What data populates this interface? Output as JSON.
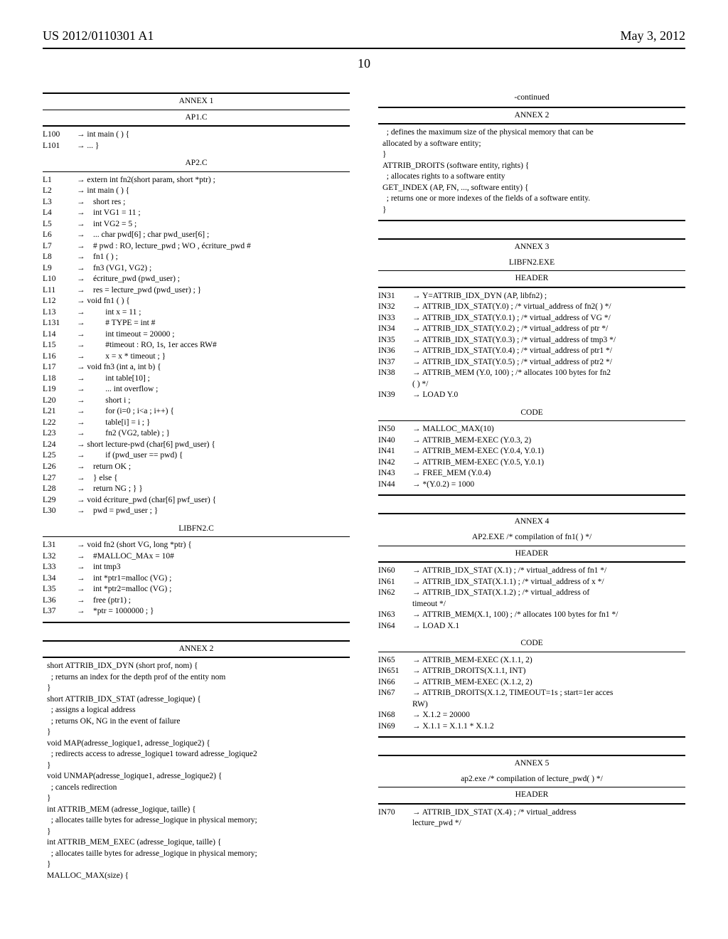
{
  "header": {
    "pub_number": "US 2012/0110301 A1",
    "pub_date": "May 3, 2012",
    "page_label": "10"
  },
  "annex1": {
    "title": "ANNEX 1",
    "sub1": "AP1.C",
    "rows1": [
      {
        "l": "L100",
        "c": "→ int main ( ) {"
      },
      {
        "l": "L101",
        "c": "→ ... }"
      }
    ],
    "sub2": "AP2.C",
    "rows2": [
      {
        "l": "L1",
        "c": "→ extern int fn2(short param, short *ptr) ;"
      },
      {
        "l": "L2",
        "c": "→ int main ( ) {"
      },
      {
        "l": "L3",
        "c": "→    short res ;"
      },
      {
        "l": "L4",
        "c": "→    int VG1 = 11 ;"
      },
      {
        "l": "L5",
        "c": "→    int VG2 = 5 ;"
      },
      {
        "l": "L6",
        "c": "→    ... char pwd[6] ; char pwd_user[6] ;"
      },
      {
        "l": "L7",
        "c": "→    # pwd : RO, lecture_pwd ; WO , écriture_pwd #"
      },
      {
        "l": "L8",
        "c": "→    fn1 ( ) ;"
      },
      {
        "l": "L9",
        "c": "→    fn3 (VG1, VG2) ;"
      },
      {
        "l": "L10",
        "c": "→    écriture_pwd (pwd_user) ;"
      },
      {
        "l": "L11",
        "c": "→    res = lecture_pwd (pwd_user) ; }"
      },
      {
        "l": "L12",
        "c": "→ void fn1 ( ) {"
      },
      {
        "l": "L13",
        "c": "→          int x = 11 ;"
      },
      {
        "l": "L131",
        "c": "→          # TYPE = int #"
      },
      {
        "l": "L14",
        "c": "→          int timeout = 20000 ;"
      },
      {
        "l": "L15",
        "c": "→          #timeout : RO, 1s, 1er acces RW#"
      },
      {
        "l": "L16",
        "c": "→          x = x * timeout ; }"
      },
      {
        "l": "L17",
        "c": "→ void fn3 (int a, int b) {"
      },
      {
        "l": "L18",
        "c": "→          int table[10] ;"
      },
      {
        "l": "L19",
        "c": "→          ... int overflow ;"
      },
      {
        "l": "L20",
        "c": "→          short i ;"
      },
      {
        "l": "L21",
        "c": "→          for (i=0 ; i<a ; i++) {"
      },
      {
        "l": "L22",
        "c": "→          table[i] = i ; }"
      },
      {
        "l": "L23",
        "c": "→          fn2 (VG2, table) ; }"
      },
      {
        "l": "L24",
        "c": "→ short lecture-pwd (char[6] pwd_user) {"
      },
      {
        "l": "L25",
        "c": "→          if (pwd_user == pwd) {"
      },
      {
        "l": "L26",
        "c": "→    return OK ;"
      },
      {
        "l": "L27",
        "c": "→    } else {"
      },
      {
        "l": "L28",
        "c": "→    return NG ; } }"
      },
      {
        "l": "L29",
        "c": "→ void écriture_pwd (char[6] pwf_user) {"
      },
      {
        "l": "L30",
        "c": "→    pwd = pwd_user ; }"
      }
    ],
    "sub3": "LIBFN2.C",
    "rows3": [
      {
        "l": "L31",
        "c": "→ void fn2 (short VG, long *ptr) {"
      },
      {
        "l": "L32",
        "c": "→    #MALLOC_MAx = 10#"
      },
      {
        "l": "L33",
        "c": "→    int tmp3"
      },
      {
        "l": "L34",
        "c": "→    int *ptr1=malloc (VG) ;"
      },
      {
        "l": "L35",
        "c": "→    int *ptr2=malloc (VG) ;"
      },
      {
        "l": "L36",
        "c": "→    free (ptr1) ;"
      },
      {
        "l": "L37",
        "c": "→    *ptr = 1000000 ; }"
      }
    ]
  },
  "annex2": {
    "title": "ANNEX 2",
    "body": "short ATTRIB_IDX_DYN (short prof, nom) {\n  ; returns an index for the depth prof of the entity nom\n}\nshort ATTRIB_IDX_STAT (adresse_logique) {\n  ; assigns a logical address\n  ; returns OK, NG in the event of failure\n}\nvoid MAP(adresse_logique1, adresse_logique2) {\n  ; redirects access to adresse_logique1 toward adresse_logique2\n}\nvoid UNMAP(adresse_logique1, adresse_logique2) {\n  ; cancels redirection\n}\nint ATTRIB_MEM (adresse_logique, taille) {\n  ; allocates taille bytes for adresse_logique in physical memory;\n}\nint ATTRIB_MEM_EXEC (adresse_logique, taille) {\n  ; allocates taille bytes for adresse_logique in physical memory;\n}\nMALLOC_MAX(size) {"
  },
  "annex2cont": {
    "continued": "-continued",
    "title": "ANNEX 2",
    "body": "  ; defines the maximum size of the physical memory that can be\nallocated by a software entity;\n}\nATTRIB_DROITS (software entity, rights) {\n  ; allocates rights to a software entity\nGET_INDEX (AP, FN, ..., software entity) {\n  ; returns one or more indexes of the fields of a software entity.\n}"
  },
  "annex3": {
    "title": "ANNEX 3",
    "sub": "LIBFN2.EXE",
    "header_label": "HEADER",
    "rowsA": [
      {
        "l": "IN31",
        "c": "→ Y=ATTRIB_IDX_DYN (AP, libfn2) ;"
      },
      {
        "l": "IN32",
        "c": "→ ATTRIB_IDX_STAT(Y.0) ; /* virtual_address of fn2( ) */"
      },
      {
        "l": "IN33",
        "c": "→ ATTRIB_IDX_STAT(Y.0.1) ; /* virtual_address of VG */"
      },
      {
        "l": "IN34",
        "c": "→ ATTRIB_IDX_STAT(Y.0.2) ; /* virtual_address of ptr */"
      },
      {
        "l": "IN35",
        "c": "→ ATTRIB_IDX_STAT(Y.0.3) ; /* virtual_address of tmp3 */"
      },
      {
        "l": "IN36",
        "c": "→ ATTRIB_IDX_STAT(Y.0.4) ; /* virtual_address of ptr1 */"
      },
      {
        "l": "IN37",
        "c": "→ ATTRIB_IDX_STAT(Y.0.5) ; /* virtual_address of ptr2 */"
      },
      {
        "l": "IN38",
        "c": "→ ATTRIB_MEM (Y.0, 100) ; /* allocates 100 bytes for fn2\n( ) */"
      },
      {
        "l": "IN39",
        "c": "→ LOAD Y.0"
      }
    ],
    "code_label": "CODE",
    "rowsB": [
      {
        "l": "IN50",
        "c": "→ MALLOC_MAX(10)"
      },
      {
        "l": "IN40",
        "c": "→ ATTRIB_MEM-EXEC (Y.0.3, 2)"
      },
      {
        "l": "IN41",
        "c": "→ ATTRIB_MEM-EXEC (Y.0.4, Y.0.1)"
      },
      {
        "l": "IN42",
        "c": "→ ATTRIB_MEM-EXEC (Y.0.5, Y.0.1)"
      },
      {
        "l": "IN43",
        "c": "→ FREE_MEM (Y.0.4)"
      },
      {
        "l": "IN44",
        "c": "→ *(Y.0.2) = 1000"
      }
    ]
  },
  "annex4": {
    "title": "ANNEX 4",
    "sub": "AP2.EXE /* compilation of fn1( ) */",
    "header_label": "HEADER",
    "rowsA": [
      {
        "l": "IN60",
        "c": "→ ATTRIB_IDX_STAT (X.1) ; /* virtual_address of fn1 */"
      },
      {
        "l": "IN61",
        "c": "→ ATTRIB_IDX_STAT(X.1.1) ; /* virtual_address of x */"
      },
      {
        "l": "IN62",
        "c": "→ ATTRIB_IDX_STAT(X.1.2) ; /* virtual_address of\ntimeout */"
      },
      {
        "l": "IN63",
        "c": "→ ATTRIB_MEM(X.1, 100) ; /* allocates 100 bytes for fn1 */"
      },
      {
        "l": "IN64",
        "c": "→ LOAD X.1"
      }
    ],
    "code_label": "CODE",
    "rowsB": [
      {
        "l": "IN65",
        "c": "→ ATTRIB_MEM-EXEC (X.1.1, 2)"
      },
      {
        "l": "IN651",
        "c": "→ ATTRIB_DROITS(X.1.1, INT)"
      },
      {
        "l": "IN66",
        "c": "→ ATTRIB_MEM-EXEC (X.1.2, 2)"
      },
      {
        "l": "IN67",
        "c": "→ ATTRIB_DROITS(X.1.2, TIMEOUT=1s ; start=1er acces\nRW)"
      },
      {
        "l": "IN68",
        "c": "→ X.1.2 = 20000"
      },
      {
        "l": "IN69",
        "c": "→ X.1.1 = X.1.1 * X.1.2"
      }
    ]
  },
  "annex5": {
    "title": "ANNEX 5",
    "sub": "ap2.exe /* compilation of lecture_pwd( ) */",
    "header_label": "HEADER",
    "rows": [
      {
        "l": "IN70",
        "c": "→ ATTRIB_IDX_STAT (X.4) ; /* virtual_address\nlecture_pwd */"
      }
    ]
  }
}
